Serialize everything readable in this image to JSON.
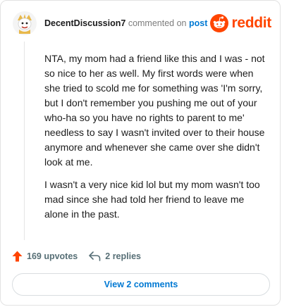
{
  "comment": {
    "username": "DecentDiscussion7",
    "commented_on": "commented on",
    "post_link": "post",
    "paragraphs": [
      "NTA, my mom had a friend like this and I was - not so nice to her as well. My first words were when she tried to scold me for something was 'I'm sorry, but I don't remember you pushing me out of your who-ha so you have no rights to parent to me' needless to say I wasn't invited over to their house anymore and whenever she came over she didn't look at me.",
      "I wasn't a very nice kid lol but my mom wasn't too mad since she had told her friend to leave me alone in the past."
    ]
  },
  "brand": {
    "name": "reddit",
    "color": "#ff4500",
    "icon": "reddit-alien-icon"
  },
  "actions": {
    "upvotes": "169 upvotes",
    "replies": "2 replies",
    "upvote_icon": "upvote-arrow-icon",
    "reply_icon": "reply-arrow-icon"
  },
  "footer": {
    "view_comments": "View 2 comments"
  },
  "colors": {
    "link_blue": "#0079d3",
    "upvote_orange": "#ff4500",
    "muted": "#7c7c7c"
  }
}
